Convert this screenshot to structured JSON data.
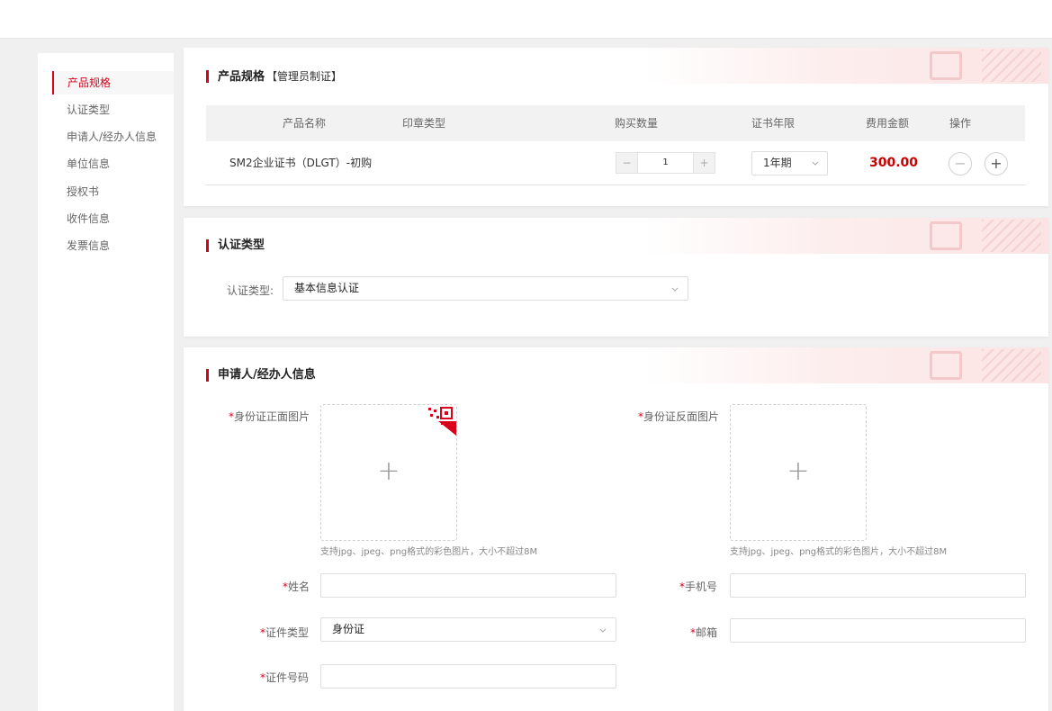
{
  "sidebar": {
    "items": [
      {
        "label": "产品规格",
        "active": true
      },
      {
        "label": "认证类型"
      },
      {
        "label": "申请人/经办人信息"
      },
      {
        "label": "单位信息"
      },
      {
        "label": "授权书"
      },
      {
        "label": "收件信息"
      },
      {
        "label": "发票信息"
      }
    ]
  },
  "spec": {
    "title": "产品规格",
    "subtitle": "【管理员制证】",
    "headers": {
      "name": "产品名称",
      "seal_type": "印章类型",
      "quantity": "购买数量",
      "years": "证书年限",
      "fee": "费用金额",
      "action": "操作"
    },
    "row": {
      "name": "SM2企业证书（DLGT）-初购",
      "quantity_minus": "−",
      "quantity": "1",
      "quantity_plus": "+",
      "years": "1年期",
      "fee": "300.00",
      "action_minus": "−",
      "action_plus": "+"
    }
  },
  "auth": {
    "title": "认证类型",
    "label": "认证类型:",
    "value": "基本信息认证"
  },
  "applicant": {
    "title": "申请人/经办人信息",
    "required_mark": "*",
    "id_front_label": "身份证正面图片",
    "id_back_label": "身份证反面图片",
    "upload_plus": "+",
    "upload_hint": "支持jpg、jpeg、png格式的彩色图片，大小不超过8M",
    "name_label": "姓名",
    "phone_label": "手机号",
    "id_type_label": "证件类型",
    "id_type_value": "身份证",
    "email_label": "邮箱",
    "id_number_label": "证件号码"
  },
  "icons": {
    "chevron": "chevron-down-icon",
    "qr": "qr-code-icon"
  },
  "colors": {
    "accent": "#d9001b",
    "price": "#c80000"
  }
}
